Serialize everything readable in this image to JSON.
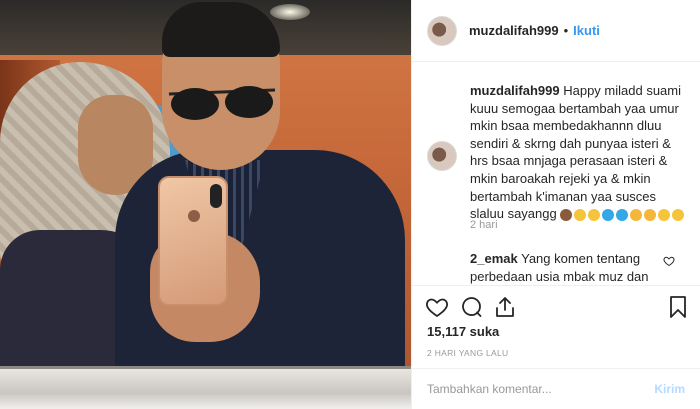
{
  "post": {
    "username": "muzdalifah999",
    "separator": "•",
    "follow_label": "Ikuti"
  },
  "caption": {
    "username": "muzdalifah999",
    "text": "Happy miladd suami kuuu semogaa bertambah yaa umur mkin bsaa membedakhannn dluu sendiri & skrng dah punyaa isteri & hrs bsaa mnjaga perasaan isteri & mkin baroakah rejeki ya & mkin bertambah k'imanan yaa susces slaluu sayangg",
    "emojis": [
      "cake",
      "kiss-face",
      "kiss-face",
      "blue-heart",
      "blue-heart",
      "praying-hands",
      "praying-hands",
      "smiling-face",
      "smiling-face"
    ],
    "time": "2 hari"
  },
  "comment2": {
    "username": "2_emak",
    "text": "Yang komen tentang perbedaan usia mbak muz dan"
  },
  "likes": "15,117 suka",
  "post_date": "2 HARI YANG LALU",
  "add_comment": {
    "placeholder": "Tambahkan komentar...",
    "post_label": "Kirim"
  },
  "colors": {
    "link_blue": "#3897f0",
    "post_disabled": "#b3dbff",
    "muted_text": "#999999",
    "text": "#262626",
    "border": "#efefef"
  },
  "icons": {
    "like": "heart-icon",
    "comment": "comment-icon",
    "share": "share-icon",
    "save": "bookmark-icon"
  }
}
